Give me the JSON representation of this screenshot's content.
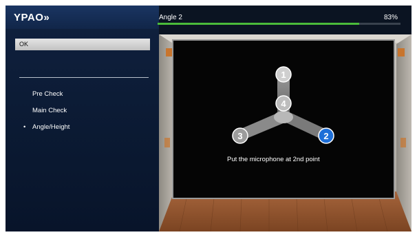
{
  "header": {
    "brand": "YPAO»",
    "step_label": "Angle 2",
    "progress_text": "83%",
    "progress_value": 0.83
  },
  "sidebar": {
    "ok_label": "OK",
    "items": [
      {
        "label": "Pre Check",
        "active": false
      },
      {
        "label": "Main Check",
        "active": false
      },
      {
        "label": "Angle/Height",
        "active": true
      }
    ],
    "bullet": "•"
  },
  "main": {
    "instruction": "Put the microphone at 2nd point",
    "points": [
      {
        "number": "1",
        "highlighted": false
      },
      {
        "number": "4",
        "highlighted": false
      },
      {
        "number": "3",
        "highlighted": false
      },
      {
        "number": "2",
        "highlighted": true
      }
    ]
  },
  "colors": {
    "sidebar_bg": "#0b1a33",
    "progress_fill": "#4bbb3a",
    "highlight_point": "#1e6fd8"
  }
}
